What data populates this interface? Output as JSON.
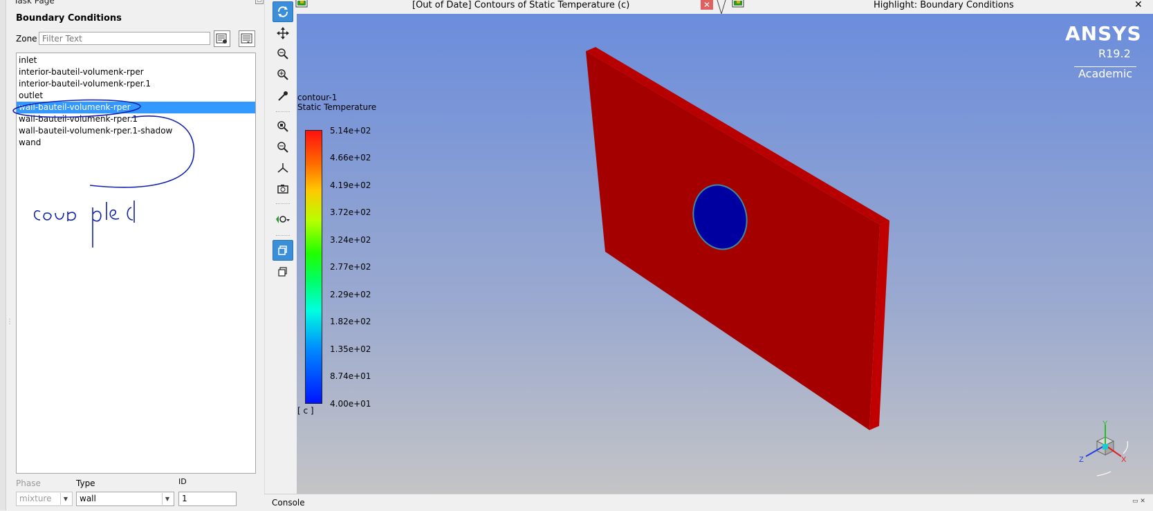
{
  "task_page": {
    "header": "Task Page",
    "title": "Boundary Conditions",
    "zone_label": "Zone",
    "filter_placeholder": "Filter Text",
    "zones": [
      "inlet",
      "interior-bauteil-volumenk-rper",
      "interior-bauteil-volumenk-rper.1",
      "outlet",
      "wall-bauteil-volumenk-rper",
      "wall-bauteil-volumenk-rper.1",
      "wall-bauteil-volumenk-rper.1-shadow",
      "wand"
    ],
    "selected_zone": "wall-bauteil-volumenk-rper",
    "phase_label": "Phase",
    "phase_value": "mixture",
    "type_label": "Type",
    "type_value": "wall",
    "id_label": "ID",
    "id_value": "1",
    "annotation": "coupled"
  },
  "tabs": [
    {
      "title": "[Out of Date] Contours of Static Temperature (c)",
      "close": "✕"
    },
    {
      "title": "Highlight: Boundary Conditions",
      "close": "✕"
    }
  ],
  "legend": {
    "name": "contour-1",
    "variable": "Static Temperature",
    "ticks": [
      "5.14e+02",
      "4.66e+02",
      "4.19e+02",
      "3.72e+02",
      "3.24e+02",
      "2.77e+02",
      "2.29e+02",
      "1.82e+02",
      "1.35e+02",
      "8.74e+01",
      "4.00e+01"
    ],
    "unit": "[ c ]"
  },
  "logo": {
    "name": "ANSYS",
    "version": "R19.2",
    "edition": "Academic"
  },
  "console": {
    "label": "Console"
  },
  "axes": {
    "x": "X",
    "y": "Y",
    "z": "Z"
  },
  "colors": {
    "selection": "#3399ff",
    "plate": "#a80000",
    "hole": "#0000a8",
    "annotation_ink": "#1020b0"
  }
}
